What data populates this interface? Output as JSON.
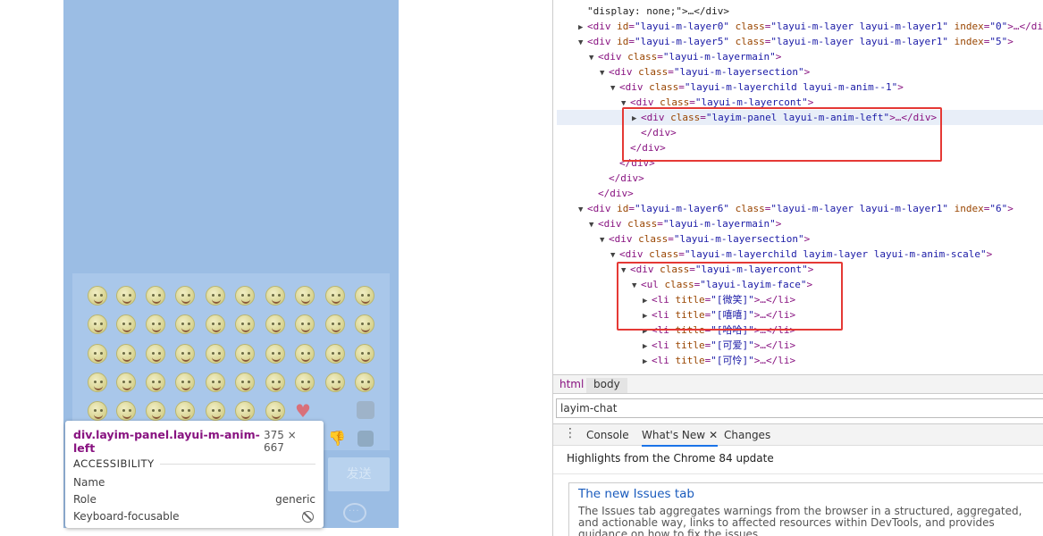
{
  "preview": {
    "send_label": "发送",
    "tooltip": {
      "selector": "div.layim-panel.layui-m-anim-left",
      "size": "375 × 667",
      "section": "ACCESSIBILITY",
      "rows": [
        {
          "label": "Name",
          "value": ""
        },
        {
          "label": "Role",
          "value": "generic"
        },
        {
          "label": "Keyboard-focusable",
          "value": ""
        }
      ]
    }
  },
  "dom_lines": [
    {
      "depth": 0,
      "tri": "",
      "parts": [
        [
          "tx",
          "\"display: none;\">…</div>"
        ]
      ]
    },
    {
      "depth": 0,
      "tri": "▶",
      "parts": [
        [
          "tag",
          "<div "
        ],
        [
          "an",
          "id"
        ],
        [
          "tag",
          "="
        ],
        [
          "av",
          "\"layui-m-layer0\""
        ],
        [
          "tag",
          " "
        ],
        [
          "an",
          "class"
        ],
        [
          "tag",
          "="
        ],
        [
          "av",
          "\"layui-m-layer layui-m-layer1\""
        ],
        [
          "tag",
          " "
        ],
        [
          "an",
          "index"
        ],
        [
          "tag",
          "="
        ],
        [
          "av",
          "\"0\""
        ],
        [
          "tag",
          ">…</di"
        ]
      ]
    },
    {
      "depth": 0,
      "tri": "▼",
      "parts": [
        [
          "tag",
          "<div "
        ],
        [
          "an",
          "id"
        ],
        [
          "tag",
          "="
        ],
        [
          "av",
          "\"layui-m-layer5\""
        ],
        [
          "tag",
          " "
        ],
        [
          "an",
          "class"
        ],
        [
          "tag",
          "="
        ],
        [
          "av",
          "\"layui-m-layer layui-m-layer1\""
        ],
        [
          "tag",
          " "
        ],
        [
          "an",
          "index"
        ],
        [
          "tag",
          "="
        ],
        [
          "av",
          "\"5\""
        ],
        [
          "tag",
          ">"
        ]
      ]
    },
    {
      "depth": 1,
      "tri": "▼",
      "parts": [
        [
          "tag",
          "<div "
        ],
        [
          "an",
          "class"
        ],
        [
          "tag",
          "="
        ],
        [
          "av",
          "\"layui-m-layermain\""
        ],
        [
          "tag",
          ">"
        ]
      ]
    },
    {
      "depth": 2,
      "tri": "▼",
      "parts": [
        [
          "tag",
          "<div "
        ],
        [
          "an",
          "class"
        ],
        [
          "tag",
          "="
        ],
        [
          "av",
          "\"layui-m-layersection\""
        ],
        [
          "tag",
          ">"
        ]
      ]
    },
    {
      "depth": 3,
      "tri": "▼",
      "parts": [
        [
          "tag",
          "<div "
        ],
        [
          "an",
          "class"
        ],
        [
          "tag",
          "="
        ],
        [
          "av",
          "\"layui-m-layerchild  layui-m-anim--1\""
        ],
        [
          "tag",
          ">"
        ]
      ]
    },
    {
      "depth": 4,
      "tri": "▼",
      "parts": [
        [
          "tag",
          "<div "
        ],
        [
          "an",
          "class"
        ],
        [
          "tag",
          "="
        ],
        [
          "av",
          "\"layui-m-layercont\""
        ],
        [
          "tag",
          ">"
        ]
      ]
    },
    {
      "depth": 5,
      "tri": "▶",
      "sel": true,
      "parts": [
        [
          "tag",
          "<div "
        ],
        [
          "an",
          "class"
        ],
        [
          "tag",
          "="
        ],
        [
          "av",
          "\"layim-panel layui-m-anim-left\""
        ],
        [
          "tag",
          ">…</div>"
        ]
      ]
    },
    {
      "depth": 5,
      "tri": "",
      "parts": [
        [
          "tag",
          "</div>"
        ]
      ]
    },
    {
      "depth": 4,
      "tri": "",
      "parts": [
        [
          "tag",
          "</div>"
        ]
      ]
    },
    {
      "depth": 3,
      "tri": "",
      "parts": [
        [
          "tag",
          "</div>"
        ]
      ]
    },
    {
      "depth": 2,
      "tri": "",
      "parts": [
        [
          "tag",
          "</div>"
        ]
      ]
    },
    {
      "depth": 1,
      "tri": "",
      "parts": [
        [
          "tag",
          "</div>"
        ]
      ]
    },
    {
      "depth": 0,
      "tri": "▼",
      "parts": [
        [
          "tag",
          "<div "
        ],
        [
          "an",
          "id"
        ],
        [
          "tag",
          "="
        ],
        [
          "av",
          "\"layui-m-layer6\""
        ],
        [
          "tag",
          " "
        ],
        [
          "an",
          "class"
        ],
        [
          "tag",
          "="
        ],
        [
          "av",
          "\"layui-m-layer layui-m-layer1\""
        ],
        [
          "tag",
          " "
        ],
        [
          "an",
          "index"
        ],
        [
          "tag",
          "="
        ],
        [
          "av",
          "\"6\""
        ],
        [
          "tag",
          ">"
        ]
      ]
    },
    {
      "depth": 1,
      "tri": "▼",
      "parts": [
        [
          "tag",
          "<div "
        ],
        [
          "an",
          "class"
        ],
        [
          "tag",
          "="
        ],
        [
          "av",
          "\"layui-m-layermain\""
        ],
        [
          "tag",
          ">"
        ]
      ]
    },
    {
      "depth": 2,
      "tri": "▼",
      "parts": [
        [
          "tag",
          "<div "
        ],
        [
          "an",
          "class"
        ],
        [
          "tag",
          "="
        ],
        [
          "av",
          "\"layui-m-layersection\""
        ],
        [
          "tag",
          ">"
        ]
      ]
    },
    {
      "depth": 3,
      "tri": "▼",
      "parts": [
        [
          "tag",
          "<div "
        ],
        [
          "an",
          "class"
        ],
        [
          "tag",
          "="
        ],
        [
          "av",
          "\"layui-m-layerchild layim-layer layui-m-anim-scale\""
        ],
        [
          "tag",
          ">"
        ]
      ]
    },
    {
      "depth": 4,
      "tri": "▼",
      "parts": [
        [
          "tag",
          "<div "
        ],
        [
          "an",
          "class"
        ],
        [
          "tag",
          "="
        ],
        [
          "av",
          "\"layui-m-layercont\""
        ],
        [
          "tag",
          ">"
        ]
      ]
    },
    {
      "depth": 5,
      "tri": "▼",
      "parts": [
        [
          "tag",
          "<ul "
        ],
        [
          "an",
          "class"
        ],
        [
          "tag",
          "="
        ],
        [
          "av",
          "\"layui-layim-face\""
        ],
        [
          "tag",
          ">"
        ]
      ]
    },
    {
      "depth": 6,
      "tri": "▶",
      "parts": [
        [
          "tag",
          "<li "
        ],
        [
          "an",
          "title"
        ],
        [
          "tag",
          "="
        ],
        [
          "av",
          "\"[微笑]\""
        ],
        [
          "tag",
          ">…</li>"
        ]
      ]
    },
    {
      "depth": 6,
      "tri": "▶",
      "parts": [
        [
          "tag",
          "<li "
        ],
        [
          "an",
          "title"
        ],
        [
          "tag",
          "="
        ],
        [
          "av",
          "\"[嘻嘻]\""
        ],
        [
          "tag",
          ">…</li>"
        ]
      ]
    },
    {
      "depth": 6,
      "tri": "▶",
      "parts": [
        [
          "tag",
          "<li "
        ],
        [
          "an",
          "title"
        ],
        [
          "tag",
          "="
        ],
        [
          "av",
          "\"[哈哈]\""
        ],
        [
          "tag",
          ">…</li>"
        ]
      ]
    },
    {
      "depth": 6,
      "tri": "▶",
      "parts": [
        [
          "tag",
          "<li "
        ],
        [
          "an",
          "title"
        ],
        [
          "tag",
          "="
        ],
        [
          "av",
          "\"[可爱]\""
        ],
        [
          "tag",
          ">…</li>"
        ]
      ]
    },
    {
      "depth": 6,
      "tri": "▶",
      "parts": [
        [
          "tag",
          "<li "
        ],
        [
          "an",
          "title"
        ],
        [
          "tag",
          "="
        ],
        [
          "av",
          "\"[可怜]\""
        ],
        [
          "tag",
          ">…</li>"
        ]
      ]
    }
  ],
  "breadcrumbs": [
    "html",
    "body"
  ],
  "search_value": "layim-chat",
  "drawer": {
    "tabs": [
      {
        "label": "Console"
      },
      {
        "label": "What's New",
        "active": true,
        "close": "✕"
      },
      {
        "label": "Changes"
      }
    ],
    "highlights": "Highlights from the Chrome 84 update",
    "card_title": "The new Issues tab",
    "card_body": "The Issues tab aggregates warnings from the browser in a structured, aggregated, and actionable way, links to affected resources within DevTools, and provides guidance on how to fix the issues."
  },
  "icons": {
    "dots": "three-dots-icon",
    "thumb": "thumb-down-icon",
    "no_sign": "no-entry-icon",
    "chat": "chat-bubble-icon"
  },
  "colors": {
    "preview_bg": "#9bbde4",
    "highlight_border": "#e53935",
    "link": "#1a5bbd"
  }
}
